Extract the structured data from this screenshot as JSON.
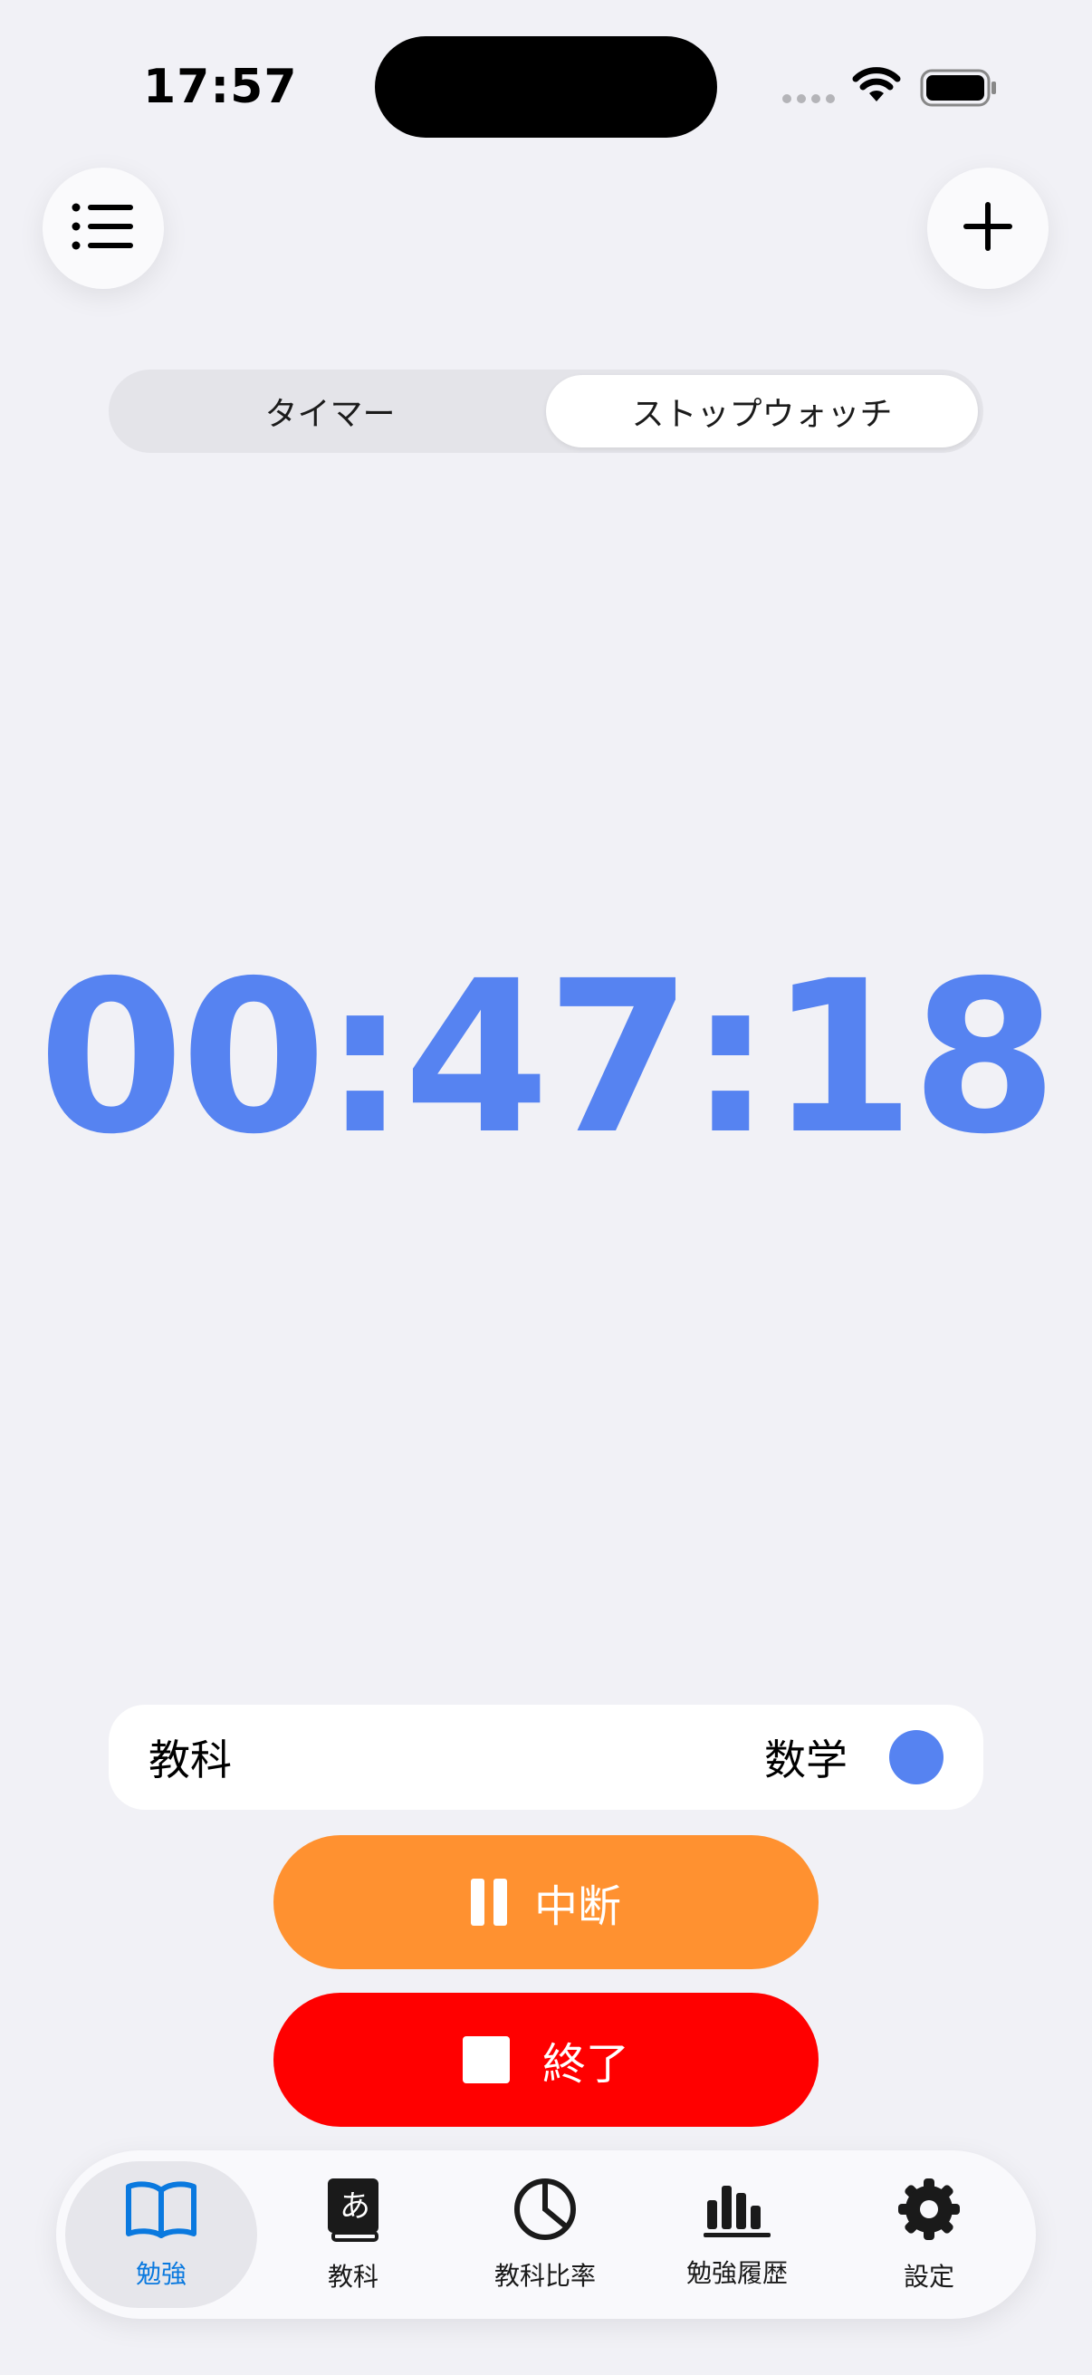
{
  "status_bar": {
    "time": "17:57"
  },
  "segment": {
    "options": [
      "タイマー",
      "ストップウォッチ"
    ],
    "selected": "ストップウォッチ"
  },
  "timer": {
    "display": "00:47:18"
  },
  "subject": {
    "label": "教科",
    "value": "数学",
    "color": "#5683F1"
  },
  "actions": {
    "pause_label": "中断",
    "stop_label": "終了"
  },
  "tabs": [
    {
      "label": "勉強",
      "icon": "book-icon",
      "active": true
    },
    {
      "label": "教科",
      "icon": "dictionary-icon"
    },
    {
      "label": "教科比率",
      "icon": "pie-chart-icon"
    },
    {
      "label": "勉強履歴",
      "icon": "bar-chart-icon"
    },
    {
      "label": "設定",
      "icon": "gear-icon"
    }
  ],
  "colors": {
    "accent": "#5683F1",
    "pause": "#FF9130",
    "stop": "#FF0000",
    "tab_active": "#0A79DF"
  }
}
